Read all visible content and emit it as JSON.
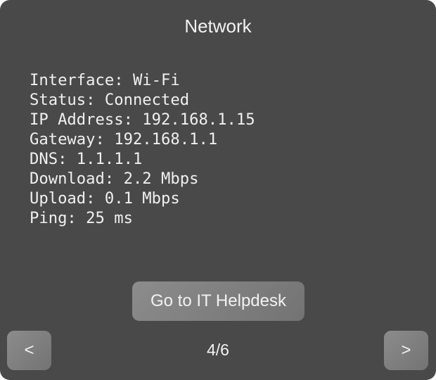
{
  "title": "Network",
  "info_lines": [
    "Interface: Wi-Fi",
    "Status: Connected",
    "IP Address: 192.168.1.15",
    "Gateway: 192.168.1.1",
    "DNS: 1.1.1.1",
    "Download: 2.2 Mbps",
    "Upload: 0.1 Mbps",
    "Ping: 25 ms"
  ],
  "helpdesk_button": "Go to IT Helpdesk",
  "prev_button": "<",
  "next_button": ">",
  "page_indicator": "4/6"
}
